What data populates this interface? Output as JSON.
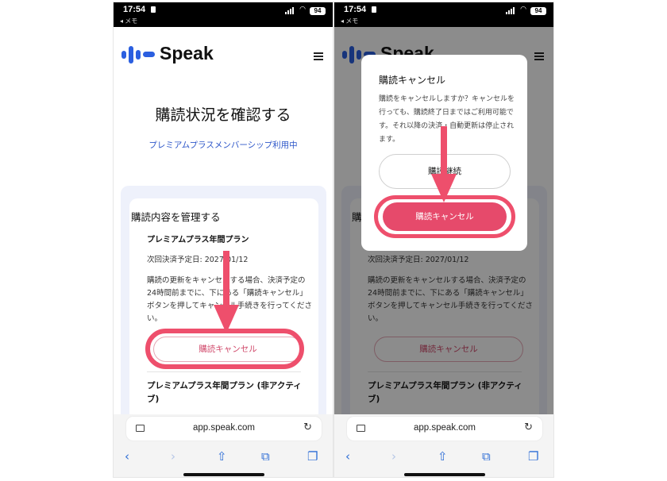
{
  "status_bar": {
    "time": "17:54",
    "back_label": "◂ メモ",
    "battery": "94"
  },
  "site": {
    "brand": "Speak"
  },
  "page": {
    "title": "購読状況を確認する",
    "membership_status": "プレミアムプラスメンバーシップ利用中",
    "card_title": "購読内容を管理する",
    "plan_name": "プレミアムプラス年間プラン",
    "next_payment": "次回決済予定日: 2027/01/12",
    "description": "購読の更新をキャンセルする場合、決済予定の24時間前までに、下にある「購読キャンセル」ボタンを押してキャンセル手続きを行ってください。",
    "cancel_button": "購読キャンセル",
    "inactive_plan": "プレミアムプラス年間プラン (非アクティブ)"
  },
  "browser": {
    "url": "app.speak.com",
    "icons": [
      "page-icon",
      "reload-icon",
      "back-icon",
      "forward-icon",
      "share-icon",
      "bookmarks-icon",
      "tabs-icon"
    ]
  },
  "dialog": {
    "title": "購読キャンセル",
    "body": "購読をキャンセルしますか？キャンセルを行っても、購読終了日まではご利用可能です。それ以降の決済・自動更新は停止されます。",
    "continue_button": "購読継続",
    "cancel_button": "購読キャンセル"
  },
  "colors": {
    "brand_blue": "#2b5fe0",
    "link_blue": "#2e57c9",
    "accent_pink": "#e64a6b",
    "annotation_red": "#ee4f6c"
  }
}
